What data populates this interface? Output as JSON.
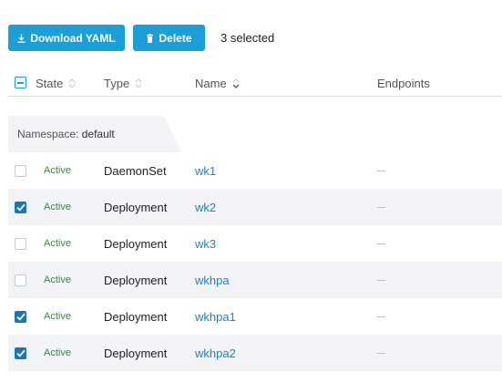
{
  "toolbar": {
    "download_label": "Download YAML",
    "delete_label": "Delete",
    "selected_text": "3 selected"
  },
  "table": {
    "headers": {
      "state": "State",
      "type": "Type",
      "name": "Name",
      "endpoints": "Endpoints"
    },
    "group": {
      "key": "Namespace:",
      "value": "default"
    },
    "rows": [
      {
        "checked": false,
        "state": "Active",
        "type": "DaemonSet",
        "name": "wk1",
        "endpoints": "—"
      },
      {
        "checked": true,
        "state": "Active",
        "type": "Deployment",
        "name": "wk2",
        "endpoints": "—"
      },
      {
        "checked": false,
        "state": "Active",
        "type": "Deployment",
        "name": "wk3",
        "endpoints": "—"
      },
      {
        "checked": false,
        "state": "Active",
        "type": "Deployment",
        "name": "wkhpa",
        "endpoints": "—"
      },
      {
        "checked": true,
        "state": "Active",
        "type": "Deployment",
        "name": "wkhpa1",
        "endpoints": "—"
      },
      {
        "checked": true,
        "state": "Active",
        "type": "Deployment",
        "name": "wkhpa2",
        "endpoints": "—"
      }
    ]
  },
  "colors": {
    "primary_button": "#1b9fd6",
    "checkbox_checked": "#1b74b4",
    "state_active": "#3d8a3d",
    "link": "#1b86c4",
    "row_alt": "#f1f3f6"
  }
}
